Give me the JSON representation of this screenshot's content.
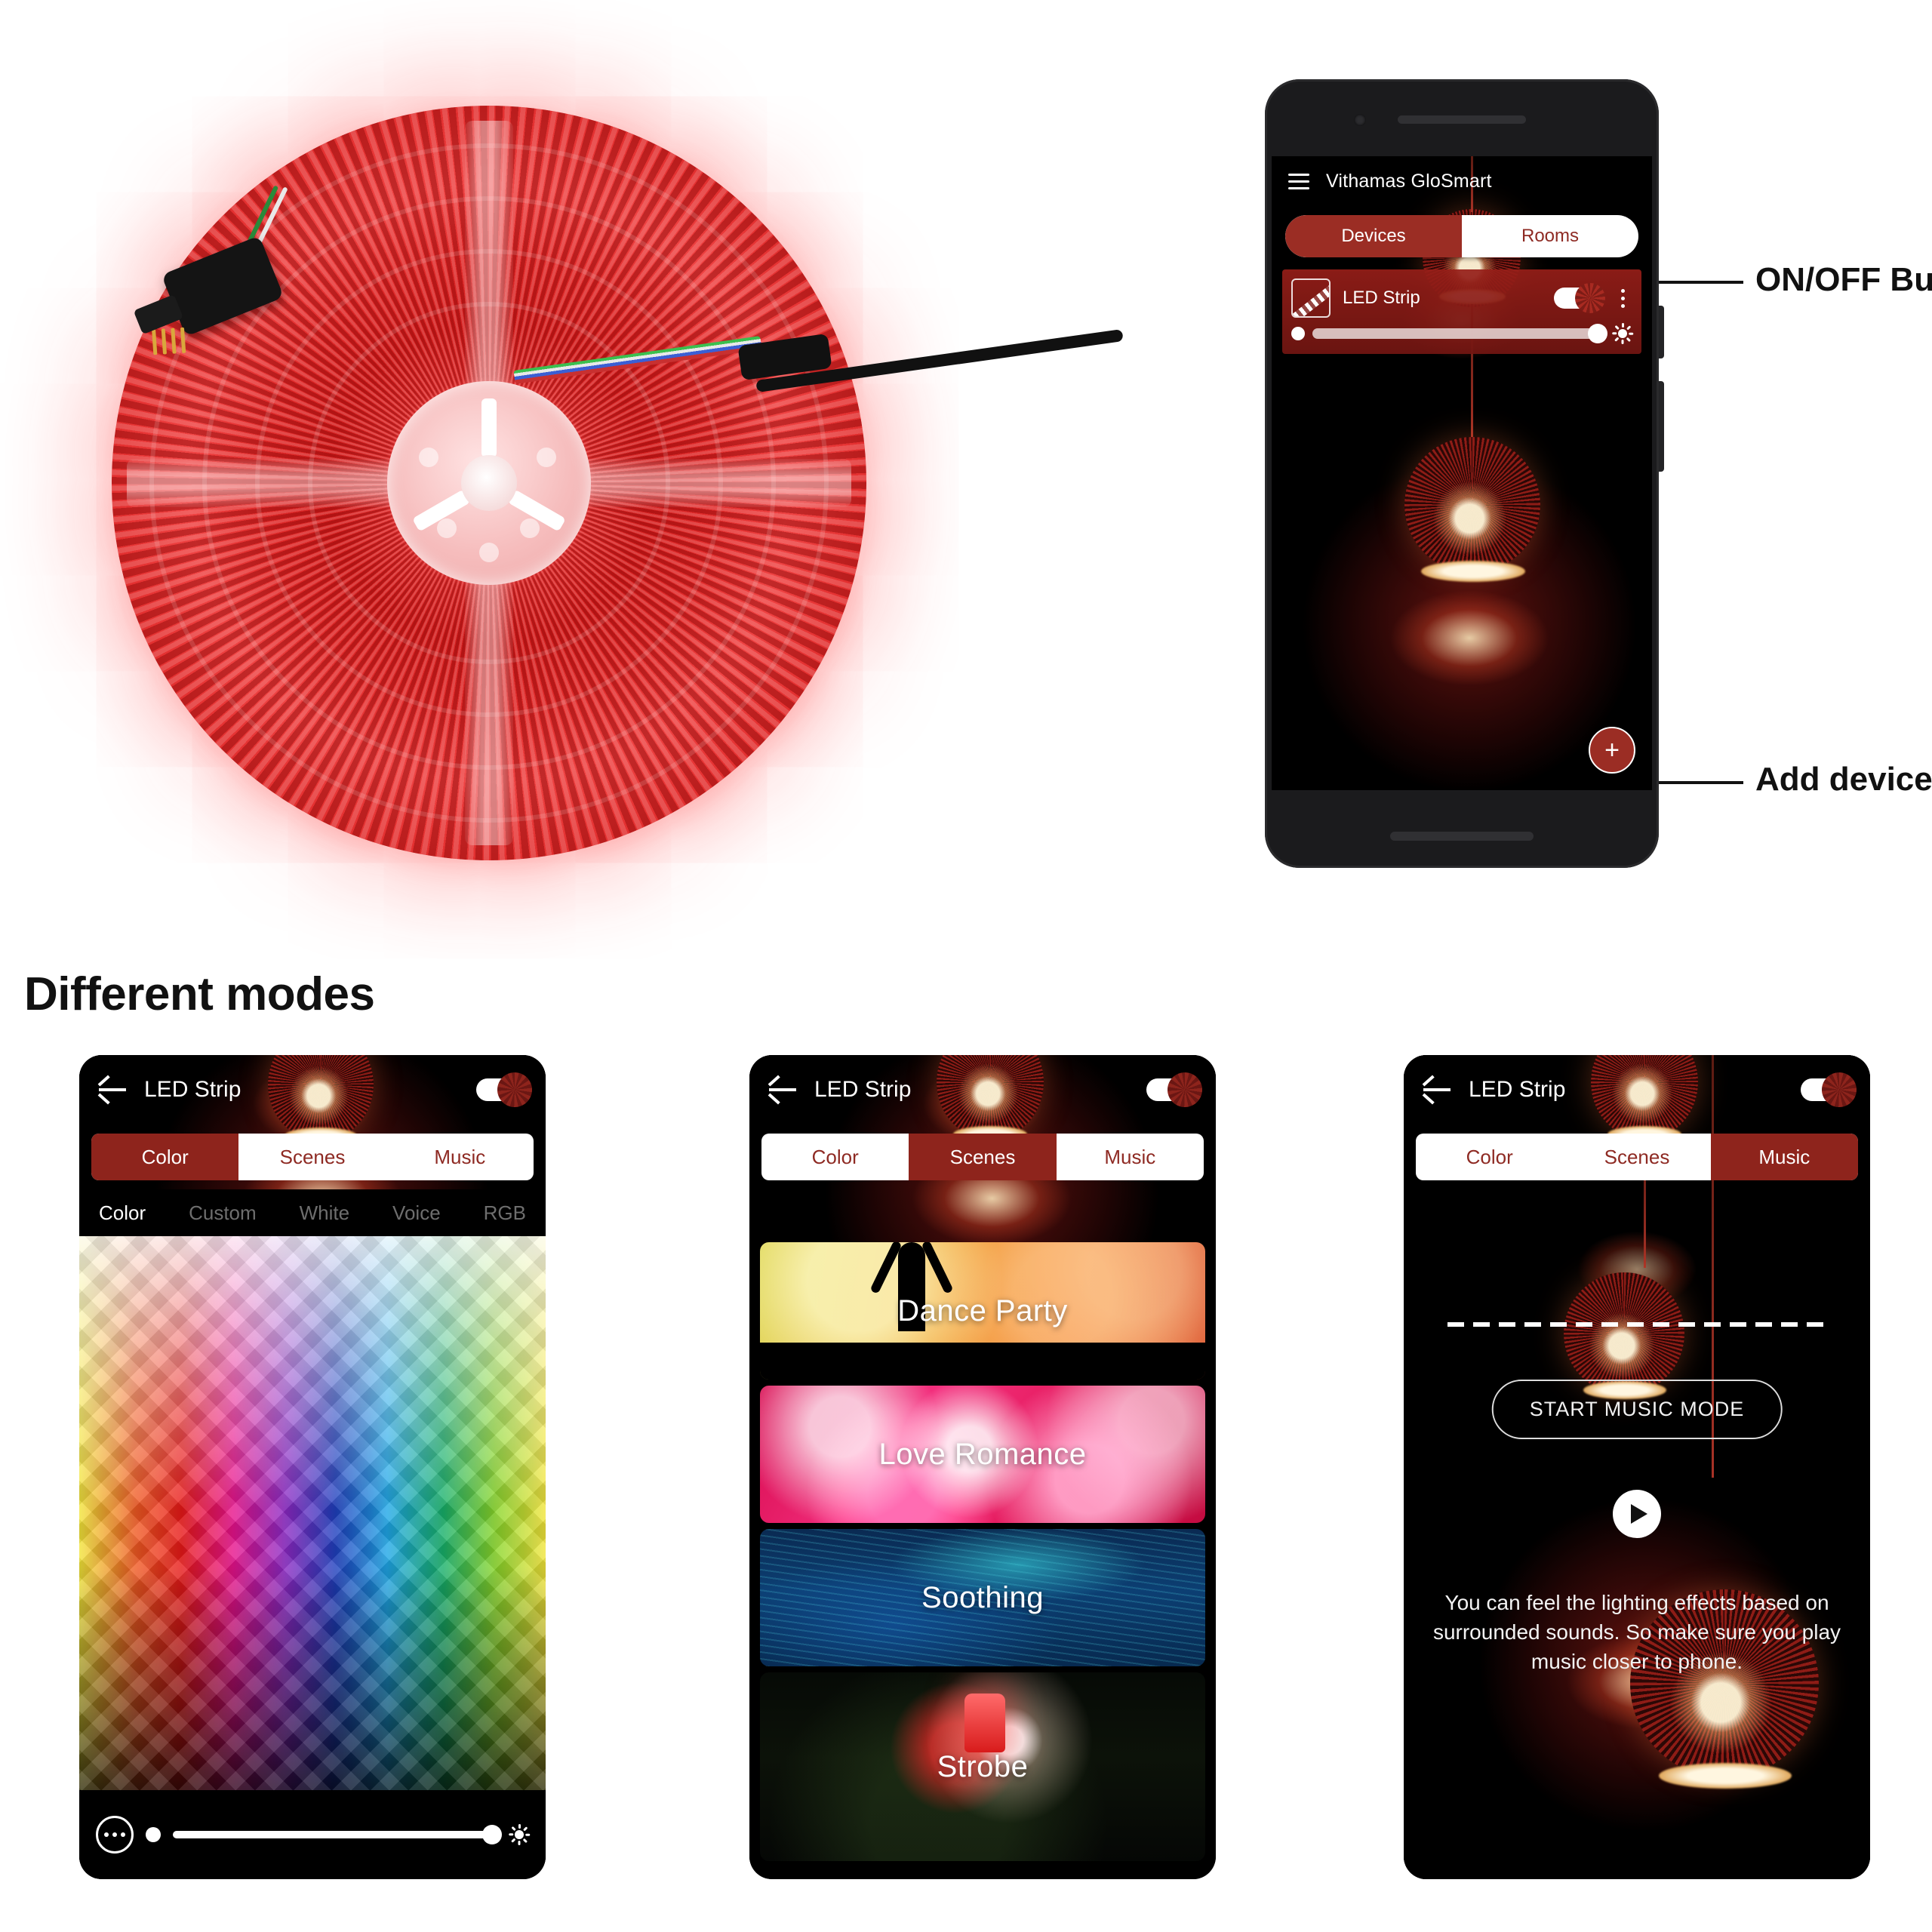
{
  "product_photo": {
    "alt": "RGB LED strip light reel glowing red with power plug and 4-pin connector cables",
    "glow_color": "#e02a2a"
  },
  "annotations": [
    {
      "id": "onoff",
      "label": "ON/OFF Button"
    },
    {
      "id": "adddevice",
      "label": "Add device"
    }
  ],
  "hero_phone": {
    "menu_icon": "hamburger-icon",
    "app_title": "Vithamas GloSmart",
    "segments": [
      {
        "label": "Devices",
        "active": true
      },
      {
        "label": "Rooms",
        "active": false
      }
    ],
    "device_card": {
      "icon": "led-strip-icon",
      "name": "LED Strip",
      "power_on": true,
      "menu_icon": "more-vertical-icon",
      "brightness_percent": 100,
      "brightness_icon": "brightness-sun-icon"
    },
    "fab": {
      "label": "+",
      "icon": "plus-icon"
    }
  },
  "section": {
    "heading": "Different modes"
  },
  "mode_phones": [
    {
      "id": "color",
      "back_icon": "back-arrow-icon",
      "title": "LED Strip",
      "power_on": true,
      "tabs": [
        {
          "label": "Color",
          "active": true
        },
        {
          "label": "Scenes",
          "active": false
        },
        {
          "label": "Music",
          "active": false
        }
      ],
      "subtabs": [
        {
          "label": "Color",
          "active": true
        },
        {
          "label": "Custom",
          "active": false
        },
        {
          "label": "White",
          "active": false
        },
        {
          "label": "Voice",
          "active": false
        },
        {
          "label": "RGB",
          "active": false
        }
      ],
      "palette": {
        "name": "diamond-color-picker"
      },
      "bottom_bar": {
        "more_icon": "ellipsis-icon",
        "brightness_percent": 100,
        "brightness_icon": "brightness-sun-icon"
      }
    },
    {
      "id": "scenes",
      "back_icon": "back-arrow-icon",
      "title": "LED Strip",
      "power_on": true,
      "tabs": [
        {
          "label": "Color",
          "active": false
        },
        {
          "label": "Scenes",
          "active": true
        },
        {
          "label": "Music",
          "active": false
        }
      ],
      "scenes": [
        {
          "label": "Dance Party"
        },
        {
          "label": "Love Romance"
        },
        {
          "label": "Soothing"
        },
        {
          "label": "Strobe"
        }
      ]
    },
    {
      "id": "music",
      "back_icon": "back-arrow-icon",
      "title": "LED Strip",
      "power_on": true,
      "tabs": [
        {
          "label": "Color",
          "active": false
        },
        {
          "label": "Scenes",
          "active": false
        },
        {
          "label": "Music",
          "active": true
        }
      ],
      "start_button": "START MUSIC MODE",
      "play_icon": "play-icon",
      "description": "You can feel the lighting effects based on surrounded sounds. So make sure you play music closer to phone."
    }
  ],
  "colors": {
    "brand_red": "#9b2d24",
    "brand_red_dark": "#8e241c",
    "text_dark": "#111111",
    "white": "#ffffff"
  }
}
